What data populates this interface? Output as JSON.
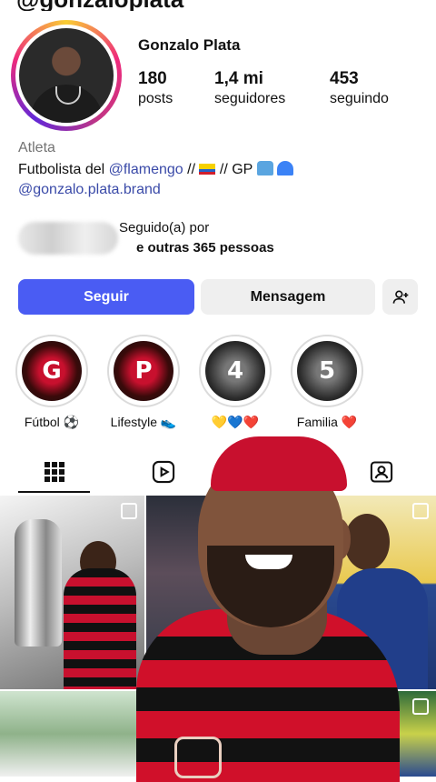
{
  "header": {
    "username_partial": "@gonzaloplata"
  },
  "profile": {
    "name": "Gonzalo Plata",
    "stats": [
      {
        "value": "180",
        "label": "posts"
      },
      {
        "value": "1,4 mi",
        "label": "seguidores"
      },
      {
        "value": "453",
        "label": "seguindo"
      }
    ],
    "category": "Atleta",
    "bio_prefix": "Futbolista del ",
    "bio_mention": "@flamengo",
    "bio_sep1": " // ",
    "bio_sep2": " // GP ",
    "bio_link": "@gonzalo.plata.brand"
  },
  "followed_by": {
    "line1_visible": "Seguido(a) por",
    "line1_blurred": " ",
    "line2_blurred": " ",
    "line2_visible": " e outras 365 pessoas"
  },
  "actions": {
    "follow": "Seguir",
    "message": "Mensagem",
    "add_icon": "person-add-icon"
  },
  "highlights": [
    {
      "letter": "G",
      "label": "Fútbol ⚽",
      "style": "red"
    },
    {
      "letter": "P",
      "label": "Lifestyle 👟",
      "style": "red"
    },
    {
      "letter": "4",
      "label": "💛💙❤️",
      "style": "gray"
    },
    {
      "letter": "5",
      "label": "Familia ❤️",
      "style": "gray"
    }
  ],
  "tabs": [
    {
      "icon": "grid-icon",
      "active": true
    },
    {
      "icon": "reels-icon",
      "active": false
    },
    {
      "icon": "tagged-icon",
      "active": false
    }
  ],
  "colors": {
    "follow_button": "#4a5cf3",
    "link": "#3a4aa8",
    "muted": "#737373"
  }
}
